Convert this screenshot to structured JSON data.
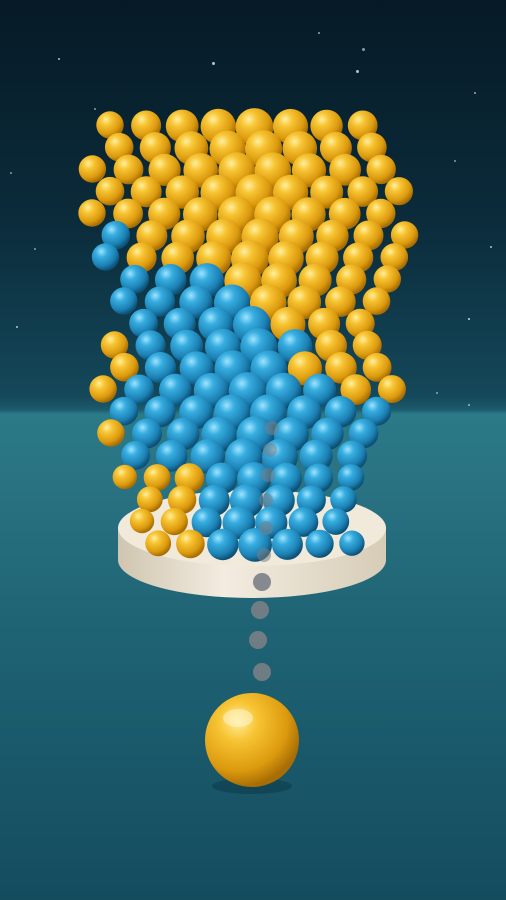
{
  "game": {
    "title": "",
    "colors": {
      "yellow": "#f2b21c",
      "blue": "#2b9fd0",
      "background_top": "#061a26",
      "floor": "#2a7a88",
      "pedestal": "#efe6d4"
    },
    "shooter_ball": {
      "color": "yellow"
    },
    "aim_guide": {
      "style": "dotted-line",
      "color": "#7a7f86"
    },
    "tower": {
      "style": "stacked-sphere-column",
      "colors": [
        "yellow",
        "blue"
      ]
    }
  }
}
